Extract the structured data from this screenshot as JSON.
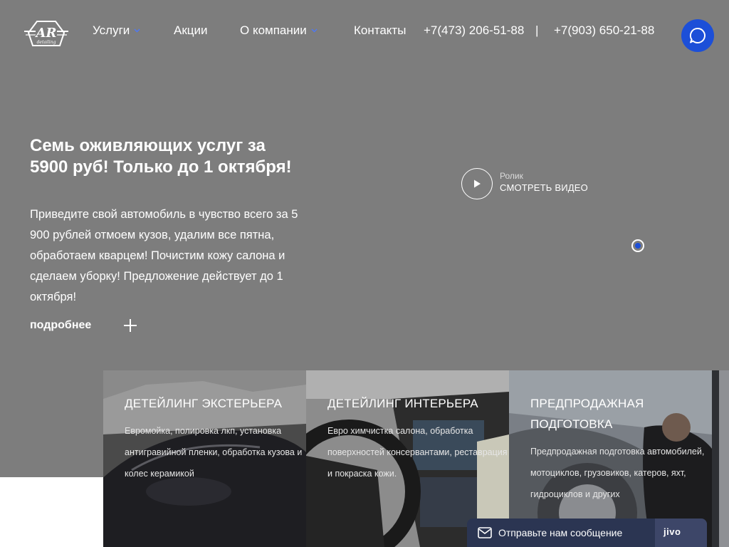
{
  "logo": {
    "letters": "AR",
    "tagline": "detailing"
  },
  "nav": {
    "items": [
      {
        "label": "Услуги",
        "dropdown": true
      },
      {
        "label": "Акции",
        "dropdown": false
      },
      {
        "label": "О компании",
        "dropdown": true
      },
      {
        "label": "Контакты",
        "dropdown": false
      }
    ],
    "phone1": "+7(473) 206-51-88",
    "separator": "|",
    "phone2": "+7(903) 650-21-88"
  },
  "hero": {
    "title": "Семь оживляющих услуг за 5900 руб! Только до 1 октября!",
    "description": "Приведите свой автомобиль в чувство всего за 5 900 рублей отмоем кузов, удалим все пятна, обработаем кварцем! Почистим кожу салона и сделаем уборку! Предложение действует до 1 октября!",
    "more_label": "подробнее",
    "video_small": "Ролик",
    "video_cta": "СМОТРЕТЬ ВИДЕО"
  },
  "cards": [
    {
      "title": "ДЕТЕЙЛИНГ ЭКСТЕРЬЕРА",
      "text": "Евромойка, полировка лкп, установка антигравийной пленки, обработка кузова и колес керамикой"
    },
    {
      "title": "ДЕТЕЙЛИНГ ИНТЕРЬЕРА",
      "text": "Евро химчистка салона, обработка поверхностей консервантами, реставрация и покраска кожи."
    },
    {
      "title": "ПРЕДПРОДАЖНАЯ ПОДГОТОВКА",
      "text": "Предпродажная подготовка автомобилей, мотоциклов, грузовиков, катеров, яхт, гидроциклов и других"
    }
  ],
  "chat_widget": {
    "label": "Отправьте нам сообщение",
    "brand": "jivo"
  },
  "colors": {
    "hero_bg": "#7d7d7d",
    "accent": "#1c4fd8",
    "widget": "#2b3552"
  }
}
